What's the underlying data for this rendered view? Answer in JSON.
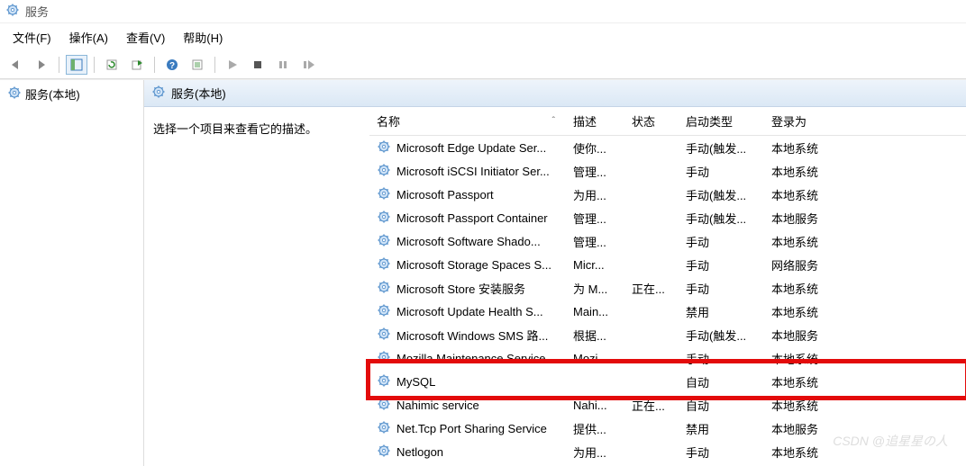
{
  "window": {
    "title": "服务"
  },
  "menu": {
    "file": "文件(F)",
    "action": "操作(A)",
    "view": "查看(V)",
    "help": "帮助(H)"
  },
  "tree": {
    "root": "服务(本地)"
  },
  "pane": {
    "title": "服务(本地)"
  },
  "description": {
    "prompt": "选择一个项目来查看它的描述。"
  },
  "columns": {
    "name": "名称",
    "desc": "描述",
    "state": "状态",
    "starttype": "启动类型",
    "logon": "登录为",
    "sort_indicator": "ˆ"
  },
  "services": [
    {
      "name": "Microsoft Edge Update Ser...",
      "desc": "使你...",
      "state": "",
      "start": "手动(触发...",
      "logon": "本地系统"
    },
    {
      "name": "Microsoft iSCSI Initiator Ser...",
      "desc": "管理...",
      "state": "",
      "start": "手动",
      "logon": "本地系统"
    },
    {
      "name": "Microsoft Passport",
      "desc": "为用...",
      "state": "",
      "start": "手动(触发...",
      "logon": "本地系统"
    },
    {
      "name": "Microsoft Passport Container",
      "desc": "管理...",
      "state": "",
      "start": "手动(触发...",
      "logon": "本地服务"
    },
    {
      "name": "Microsoft Software Shado...",
      "desc": "管理...",
      "state": "",
      "start": "手动",
      "logon": "本地系统"
    },
    {
      "name": "Microsoft Storage Spaces S...",
      "desc": "Micr...",
      "state": "",
      "start": "手动",
      "logon": "网络服务"
    },
    {
      "name": "Microsoft Store 安装服务",
      "desc": "为 M...",
      "state": "正在...",
      "start": "手动",
      "logon": "本地系统"
    },
    {
      "name": "Microsoft Update Health S...",
      "desc": "Main...",
      "state": "",
      "start": "禁用",
      "logon": "本地系统"
    },
    {
      "name": "Microsoft Windows SMS 路...",
      "desc": "根据...",
      "state": "",
      "start": "手动(触发...",
      "logon": "本地服务"
    },
    {
      "name": "Mozilla Maintenance Service",
      "desc": "Mozi...",
      "state": "",
      "start": "手动",
      "logon": "本地系统"
    },
    {
      "name": "MySQL",
      "desc": "",
      "state": "",
      "start": "自动",
      "logon": "本地系统"
    },
    {
      "name": "Nahimic service",
      "desc": "Nahi...",
      "state": "正在...",
      "start": "自动",
      "logon": "本地系统"
    },
    {
      "name": "Net.Tcp Port Sharing Service",
      "desc": "提供...",
      "state": "",
      "start": "禁用",
      "logon": "本地服务"
    },
    {
      "name": "Netlogon",
      "desc": "为用...",
      "state": "",
      "start": "手动",
      "logon": "本地系统"
    }
  ],
  "highlight_index": 10,
  "watermark": "CSDN @追星星の人"
}
